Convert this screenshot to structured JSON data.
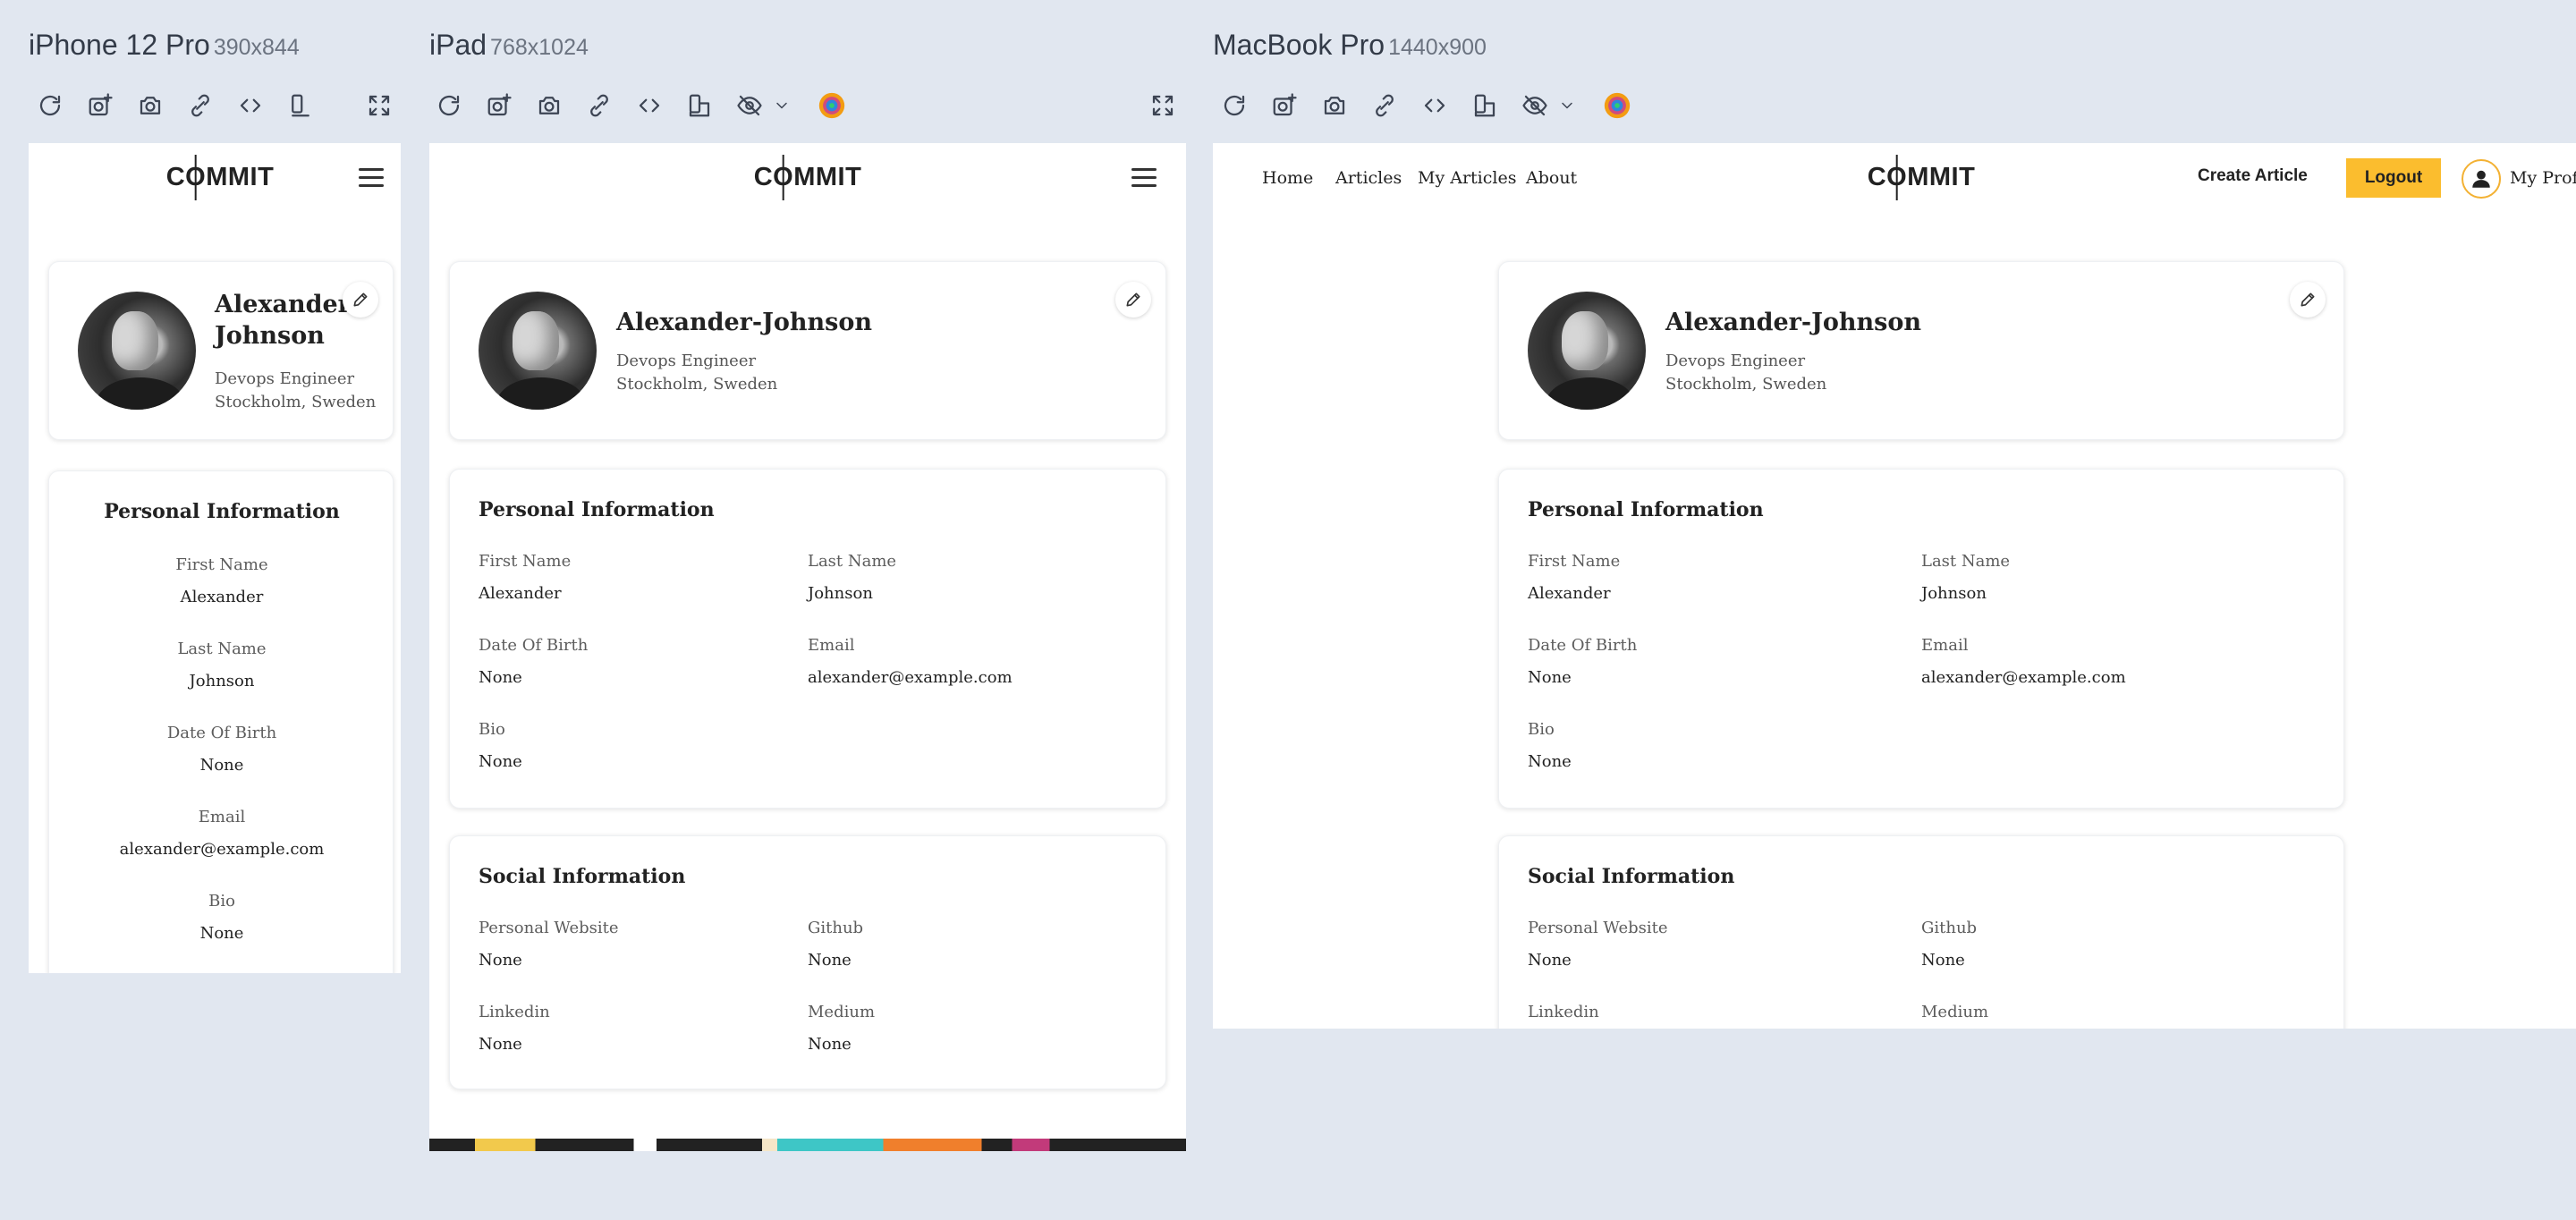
{
  "devices": [
    {
      "name": "iPhone 12 Pro",
      "dims": "390x844"
    },
    {
      "name": "iPad",
      "dims": "768x1024"
    },
    {
      "name": "MacBook Pro",
      "dims": "1440x900"
    }
  ],
  "toolbar_icons": [
    "refresh-icon",
    "add-screenshot-icon",
    "camera-icon",
    "link-icon",
    "code-icon",
    "rotate-device-icon",
    "hide-icon",
    "chevron-down-icon",
    "color-picker-icon",
    "fullscreen-icon"
  ],
  "site": {
    "logo": "COMMIT",
    "logo_pre": "C",
    "logo_ring": "O",
    "logo_post": "MMIT",
    "nav": {
      "home": "Home",
      "articles": "Articles",
      "my_articles": "My Articles",
      "about": "About",
      "create": "Create Article",
      "logout": "Logout",
      "profile": "My Profile"
    }
  },
  "profile": {
    "name": "Alexander-Johnson",
    "name_line1": "Alexander-",
    "name_line2": "Johnson",
    "title": "Devops Engineer",
    "location": "Stockholm, Sweden"
  },
  "personal": {
    "heading": "Personal Information",
    "first_name_label": "First Name",
    "first_name": "Alexander",
    "last_name_label": "Last Name",
    "last_name": "Johnson",
    "dob_label": "Date Of Birth",
    "dob": "None",
    "email_label": "Email",
    "email": "alexander@example.com",
    "bio_label": "Bio",
    "bio": "None"
  },
  "social": {
    "heading": "Social Information",
    "website_label": "Personal Website",
    "website": "None",
    "github_label": "Github",
    "github": "None",
    "linkedin_label": "Linkedin",
    "linkedin": "None",
    "medium_label": "Medium",
    "medium": "None"
  },
  "colors": {
    "page_bg": "#e1e7f0",
    "accent": "#fbbd2e",
    "card_bg": "#ffffff"
  }
}
